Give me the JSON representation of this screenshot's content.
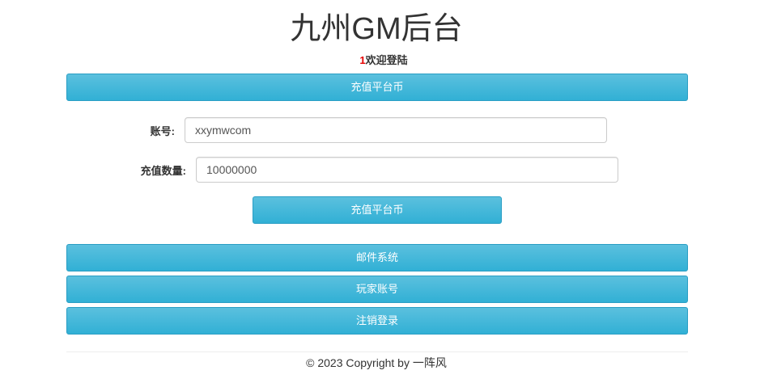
{
  "header": {
    "title": "九州GM后台",
    "welcome_uid": "1",
    "welcome_text": "欢迎登陆"
  },
  "section_button": {
    "label": "充值平台币"
  },
  "form": {
    "account_label": "账号:",
    "account_value": "xxymwcom",
    "amount_label": "充值数量:",
    "amount_value": "10000000",
    "submit_label": "充值平台币"
  },
  "nav": {
    "mail_label": "邮件系统",
    "player_label": "玩家账号",
    "logout_label": "注销登录"
  },
  "footer": {
    "text": "© 2023 Copyright by 一阵风"
  }
}
